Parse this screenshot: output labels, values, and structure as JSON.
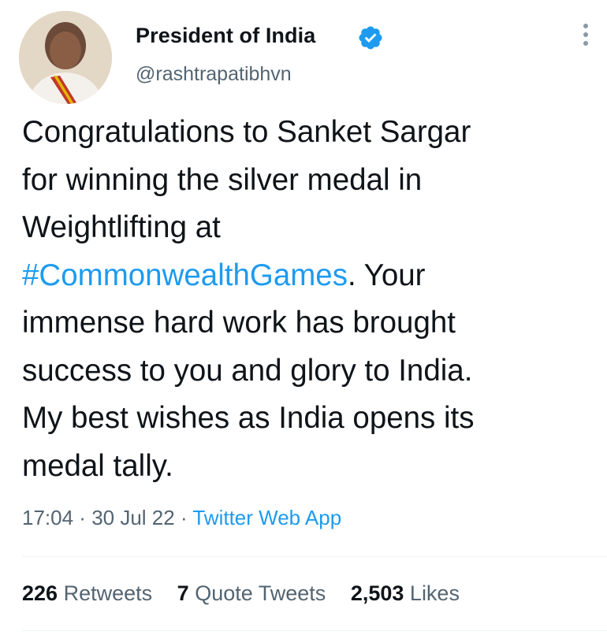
{
  "author": {
    "display_name": "President of India",
    "handle": "@rashtrapatibhvn",
    "verified": true,
    "verified_icon": "verified-badge-icon"
  },
  "tweet": {
    "lines": [
      {
        "text": "Congratulations to Sanket Sargar"
      },
      {
        "text": "for winning the silver medal in"
      },
      {
        "text": "Weightlifting at"
      },
      {
        "hashtag": "#CommonwealthGames",
        "text": ". Your"
      },
      {
        "text": "immense hard work has brought"
      },
      {
        "text": "success to you and glory to India."
      },
      {
        "text": "My best wishes as India opens its"
      },
      {
        "text": "medal tally."
      }
    ],
    "time": "17:04",
    "date": "30 Jul 22",
    "separator": " · ",
    "source": "Twitter Web App"
  },
  "stats": {
    "retweets_count": "226",
    "retweets_label": "Retweets",
    "quotes_count": "7",
    "quotes_label": "Quote Tweets",
    "likes_count": "2,503",
    "likes_label": "Likes"
  },
  "colors": {
    "link": "#1d9bf0",
    "text": "#0f1419",
    "secondary": "#536471"
  }
}
